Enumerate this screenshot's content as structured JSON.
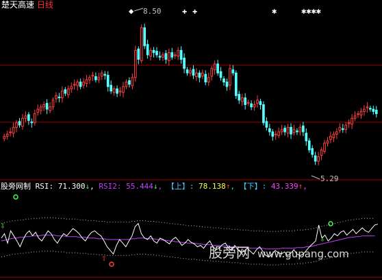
{
  "header": {
    "indicator_name": "楚天高速",
    "period": "日线"
  },
  "indicator_bar": {
    "name": "股旁网制",
    "rsi_label": "RSI:",
    "rsi_value": "71.300",
    "rsi_arrow": "↓",
    "rsi2_label": "RSI2:",
    "rsi2_value": "55.444",
    "rsi2_arrow": "↓",
    "upper_label": "【上】",
    "upper_value": "78.138",
    "upper_arrow": "↑",
    "lower_label": "【下】",
    "lower_value": "43.339",
    "lower_arrow": "↑"
  },
  "watermark": {
    "cn": "股旁网",
    "url": "www.gupang.com"
  },
  "colors": {
    "background": "#000000",
    "up_candle": "#ff4040",
    "down_candle": "#54ffff",
    "grid": "#a00000",
    "rsi_line": "#ffffff",
    "rsi2_line": "#c040ff",
    "band_dots": "#c0c0c0",
    "title_white": "#ffffff",
    "title_red": "#ff3030",
    "rsi2_text": "#c040ff",
    "bracket_text": "#40c8ff",
    "upper_value": "#ffff40",
    "lower_value": "#ff40ff",
    "up_arrow": "#ff4040",
    "down_arrow": "#40ff40"
  },
  "chart_data": [
    {
      "type": "candlestick",
      "title": "楚天高速 日线",
      "annotations": [
        {
          "text": "8.50",
          "kind": "high"
        },
        {
          "text": "5.29",
          "kind": "low"
        }
      ],
      "ylim": [
        5.0,
        8.7
      ],
      "close_series": [
        5.9,
        5.95,
        6.0,
        6.1,
        6.2,
        6.15,
        6.3,
        6.35,
        6.25,
        6.2,
        6.4,
        6.5,
        6.55,
        6.6,
        6.5,
        6.55,
        6.7,
        6.8,
        6.75,
        6.9,
        6.85,
        6.95,
        7.0,
        7.05,
        7.1,
        7.0,
        7.1,
        7.15,
        7.2,
        7.25,
        7.15,
        7.2,
        7.3,
        7.25,
        7.0,
        6.9,
        6.95,
        6.85,
        6.9,
        7.0,
        7.1,
        7.05,
        7.2,
        7.8,
        7.6,
        8.3,
        7.9,
        7.7,
        7.8,
        7.75,
        7.7,
        7.65,
        7.7,
        7.6,
        7.75,
        7.65,
        7.7,
        7.8,
        7.6,
        7.4,
        7.3,
        7.35,
        7.25,
        7.3,
        7.2,
        7.3,
        7.1,
        7.2,
        7.4,
        7.5,
        7.3,
        7.2,
        7.1,
        7.0,
        7.4,
        7.3,
        6.8,
        6.7,
        6.75,
        6.6,
        6.65,
        6.55,
        6.6,
        6.7,
        6.6,
        6.2,
        6.1,
        6.0,
        5.9,
        5.95,
        6.0,
        6.05,
        6.0,
        6.1,
        5.95,
        6.05,
        6.0,
        6.1,
        6.0,
        5.8,
        5.6,
        5.5,
        5.35,
        5.45,
        5.6,
        5.75,
        5.8,
        5.9,
        5.95,
        6.0,
        6.1,
        6.05,
        6.15,
        6.2,
        6.3,
        6.35,
        6.4,
        6.45,
        6.5,
        6.55,
        6.5,
        6.45,
        6.4
      ]
    },
    {
      "type": "line",
      "series": [
        {
          "name": "RSI",
          "values": [
            52,
            58,
            45,
            62,
            55,
            48,
            40,
            50,
            58,
            62,
            55,
            60,
            52,
            48,
            55,
            62,
            58,
            50,
            45,
            52,
            58,
            55,
            60,
            65,
            62,
            58,
            52,
            48,
            55,
            60,
            62,
            58,
            55,
            48,
            40,
            35,
            30,
            42,
            50,
            45,
            40,
            48,
            55,
            68,
            72,
            58,
            52,
            50,
            55,
            48,
            45,
            52,
            50,
            47,
            44,
            50,
            53,
            48,
            42,
            45,
            50,
            46,
            44,
            40,
            42,
            38,
            44,
            48,
            40,
            36,
            38,
            43,
            45,
            38,
            35,
            42,
            36,
            32,
            34,
            38,
            34,
            30,
            36,
            40,
            34,
            28,
            26,
            30,
            35,
            32,
            30,
            33,
            28,
            31,
            36,
            30,
            28,
            30,
            35,
            40,
            44,
            48,
            70,
            52,
            56,
            48,
            52,
            58,
            55,
            60,
            62,
            56,
            60,
            64,
            58,
            62,
            66,
            62,
            60,
            65,
            70,
            71
          ]
        },
        {
          "name": "RSI2",
          "values": [
            48,
            49,
            50,
            51,
            52,
            52,
            53,
            53,
            54,
            54,
            55,
            55,
            55,
            56,
            56,
            56,
            56,
            56,
            55,
            55,
            55,
            54,
            54,
            54,
            54,
            53,
            53,
            53,
            52,
            52,
            52,
            51,
            51,
            51,
            50,
            50,
            50,
            50,
            50,
            50,
            50,
            50,
            51,
            51,
            52,
            52,
            52,
            51,
            51,
            51,
            50,
            50,
            49,
            49,
            48,
            48,
            47,
            47,
            46,
            46,
            45,
            45,
            45,
            44,
            44,
            43,
            43,
            43,
            42,
            42,
            42,
            41,
            41,
            41,
            40,
            40,
            40,
            39,
            39,
            39,
            38,
            38,
            38,
            38,
            38,
            37,
            37,
            37,
            37,
            37,
            38,
            38,
            38,
            38,
            38,
            39,
            39,
            39,
            40,
            40,
            41,
            42,
            43,
            44,
            45,
            46,
            47,
            48,
            49,
            50,
            51,
            52,
            53,
            53,
            54,
            54,
            55,
            55,
            55,
            55,
            55
          ]
        }
      ],
      "ylim": [
        0,
        100
      ]
    }
  ]
}
